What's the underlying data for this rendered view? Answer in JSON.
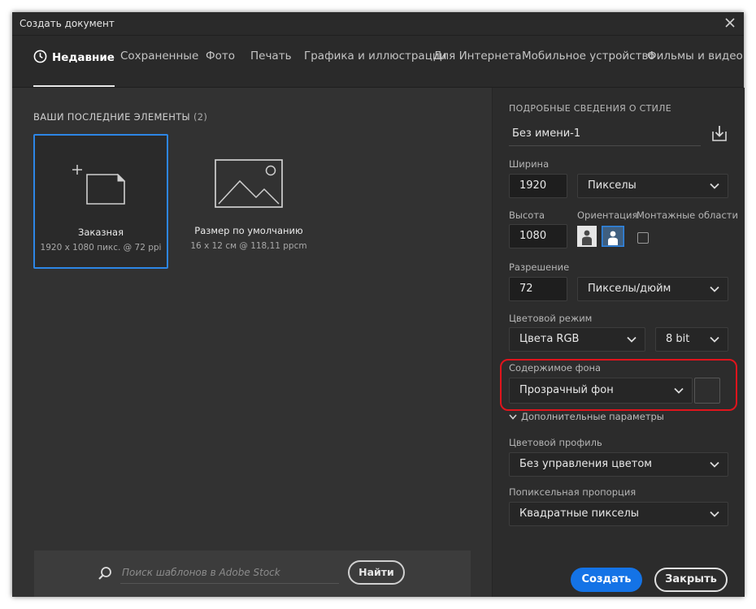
{
  "window": {
    "title": "Создать документ"
  },
  "tabs": [
    {
      "label": "Недавние",
      "active": true
    },
    {
      "label": "Сохраненные"
    },
    {
      "label": "Фото"
    },
    {
      "label": "Печать"
    },
    {
      "label": "Графика и иллюстрации"
    },
    {
      "label": "Для Интернета"
    },
    {
      "label": "Мобильное устройство"
    },
    {
      "label": "Фильмы и видео"
    }
  ],
  "recent": {
    "title": "ВАШИ ПОСЛЕДНИЕ ЭЛЕМЕНТЫ",
    "count": "(2)",
    "items": [
      {
        "name": "Заказная",
        "details": "1920 x 1080 пикс. @ 72 ppi",
        "selected": true,
        "icon": "custom-document-icon"
      },
      {
        "name": "Размер по умолчанию",
        "details": "16 x 12 см @ 118,11 ppcm",
        "icon": "image-placeholder-icon"
      }
    ]
  },
  "search": {
    "placeholder": "Поиск шаблонов в Adobe Stock",
    "button": "Найти"
  },
  "details": {
    "section_title": "ПОДРОБНЫЕ СВЕДЕНИЯ О СТИЛЕ",
    "doc_name": "Без имени-1",
    "width_label": "Ширина",
    "width_value": "1920",
    "width_unit": "Пикселы",
    "height_label": "Высота",
    "height_value": "1080",
    "orientation_label": "Ориентация",
    "artboards_label": "Монтажные области",
    "resolution_label": "Разрешение",
    "resolution_value": "72",
    "resolution_unit": "Пикселы/дюйм",
    "color_mode_label": "Цветовой режим",
    "color_mode_value": "Цвета RGB",
    "bit_depth_value": "8 bit",
    "background_label": "Содержимое фона",
    "background_value": "Прозрачный фон",
    "advanced_label": "Дополнительные параметры",
    "color_profile_label": "Цветовой профиль",
    "color_profile_value": "Без управления цветом",
    "pixel_aspect_label": "Попиксельная пропорция",
    "pixel_aspect_value": "Квадратные пикселы"
  },
  "actions": {
    "create": "Создать",
    "close": "Закрыть"
  },
  "colors": {
    "accent": "#1473e6",
    "highlight": "#e0141c",
    "selected_border": "#2d86e6"
  }
}
